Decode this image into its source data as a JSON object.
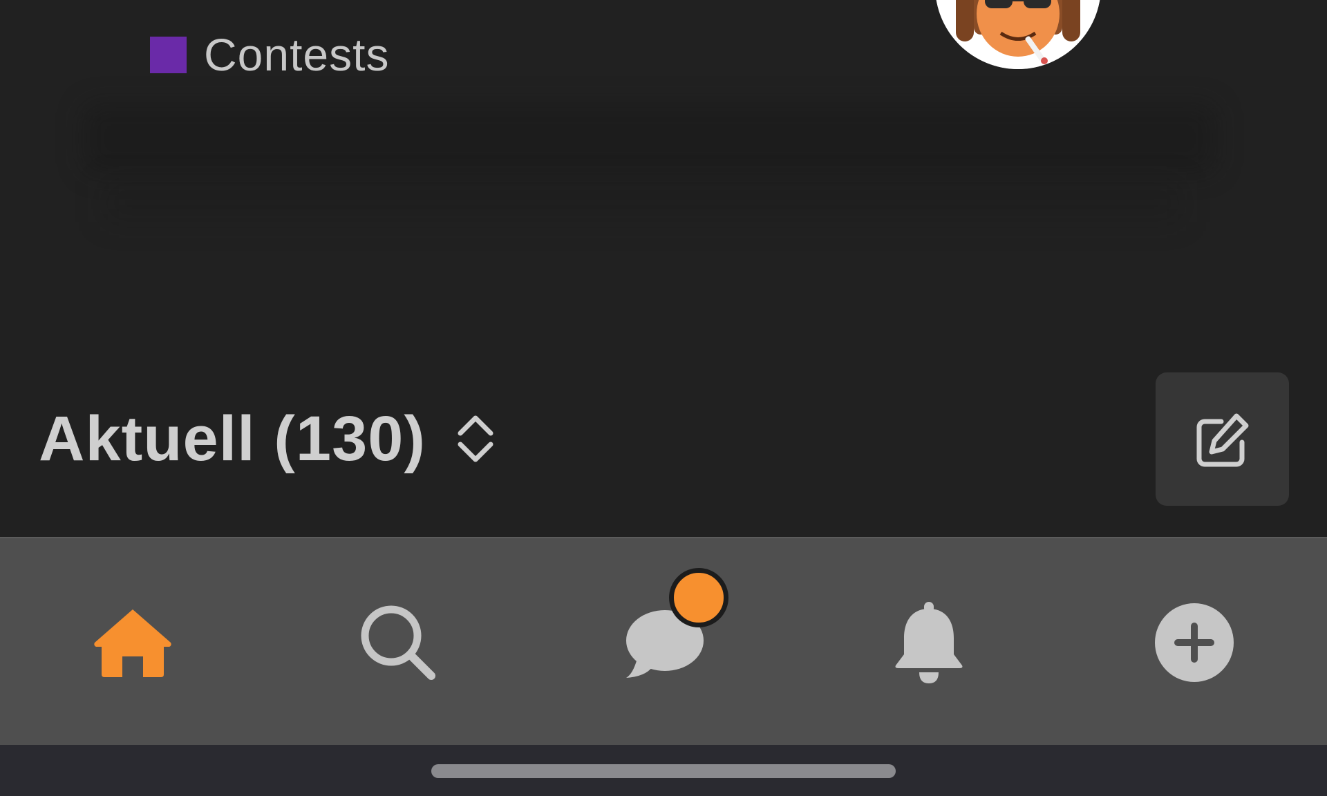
{
  "category": {
    "label": "Contests",
    "color": "#6a2aa8"
  },
  "avatar": {
    "icon": "cartoon-avatar"
  },
  "list_header": {
    "title": "Aktuell (130)",
    "sort_icon": "chevron-up-down-icon"
  },
  "compose": {
    "icon": "edit-icon"
  },
  "tabbar": {
    "active_color": "#f7902f",
    "inactive_color": "#c6c6c6",
    "tabs": [
      {
        "name": "home",
        "icon": "home-icon",
        "active": true
      },
      {
        "name": "search",
        "icon": "search-icon",
        "active": false
      },
      {
        "name": "messages",
        "icon": "chat-icon",
        "active": false,
        "has_badge": true
      },
      {
        "name": "notifications",
        "icon": "bell-icon",
        "active": false
      },
      {
        "name": "create",
        "icon": "plus-circle-icon",
        "active": false
      }
    ]
  }
}
